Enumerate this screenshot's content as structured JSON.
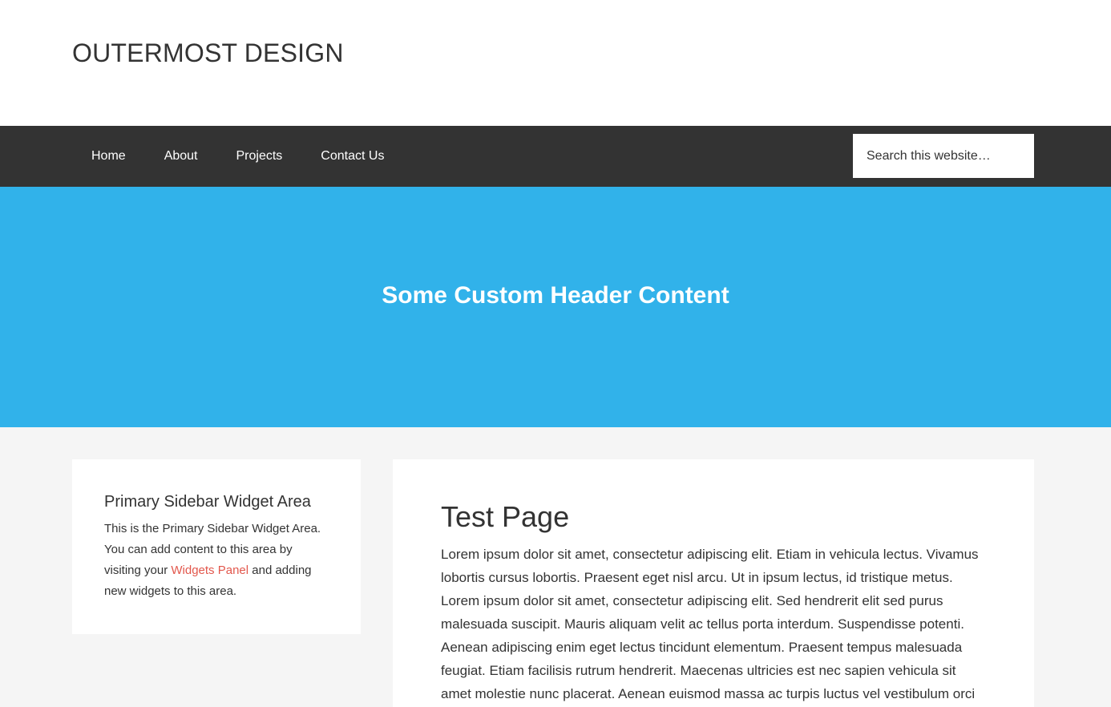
{
  "header": {
    "site_title": "OUTERMOST DESIGN"
  },
  "nav": {
    "items": [
      {
        "label": "Home"
      },
      {
        "label": "About"
      },
      {
        "label": "Projects"
      },
      {
        "label": "Contact Us"
      }
    ],
    "search_placeholder": "Search this website…"
  },
  "hero": {
    "title": "Some Custom Header Content",
    "background_color": "#31b2ea"
  },
  "sidebar": {
    "widget_title": "Primary Sidebar Widget Area",
    "text_before_link": "This is the Primary Sidebar Widget Area. You can add content to this area by visiting your ",
    "link_label": "Widgets Panel",
    "text_after_link": " and adding new widgets to this area.",
    "link_color": "#e2574c"
  },
  "main": {
    "page_title": "Test Page",
    "body_text": "Lorem ipsum dolor sit amet, consectetur adipiscing elit. Etiam in vehicula lectus. Vivamus lobortis cursus lobortis. Praesent eget nisl arcu. Ut in ipsum lectus, id tristique metus. Lorem ipsum dolor sit amet, consectetur adipiscing elit. Sed hendrerit elit sed purus malesuada suscipit. Mauris aliquam velit ac tellus porta interdum. Suspendisse potenti. Aenean adipiscing enim eget lectus tincidunt elementum. Praesent tempus malesuada feugiat. Etiam facilisis rutrum hendrerit. Maecenas ultricies est nec sapien vehicula sit amet molestie nunc placerat. Aenean euismod massa ac turpis luctus vel vestibulum orci"
  },
  "colors": {
    "nav_background": "#333333",
    "page_background": "#f5f5f5"
  }
}
